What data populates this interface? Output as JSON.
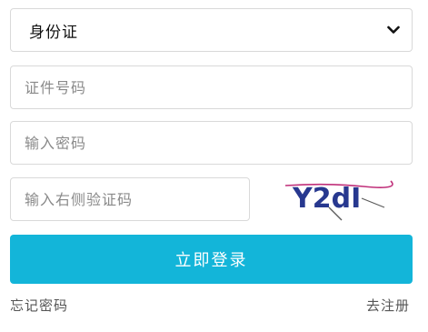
{
  "id_type_select": {
    "selected": "身份证",
    "options": [
      "身份证"
    ]
  },
  "id_number_input": {
    "value": "",
    "placeholder": "证件号码"
  },
  "password_input": {
    "value": "",
    "placeholder": "输入密码"
  },
  "captcha_input": {
    "value": "",
    "placeholder": "输入右侧验证码"
  },
  "captcha_image": {
    "text": "Y2dI"
  },
  "login_button": {
    "label": "立即登录"
  },
  "links": {
    "forgot_password": "忘记密码",
    "register": "去注册"
  },
  "colors": {
    "primary_button": "#13b5d9",
    "captcha_text": "#27388f",
    "captcha_line": "#c0307a"
  },
  "icons": {
    "select_arrow": "chevron-down-icon"
  }
}
